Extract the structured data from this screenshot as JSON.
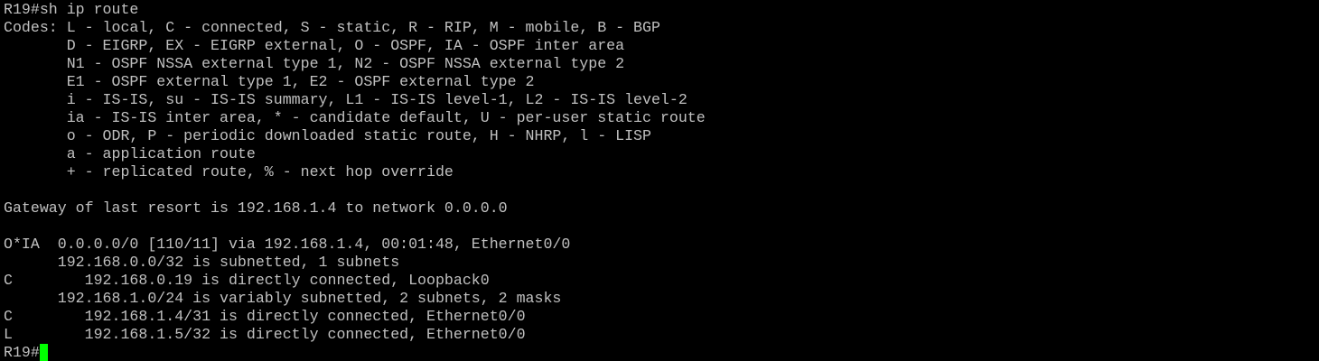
{
  "terminal": {
    "text_color": "#c0c0c0",
    "background_color": "#000000",
    "cursor_color": "#00ff00",
    "lines": [
      "R19#sh ip route",
      "Codes: L - local, C - connected, S - static, R - RIP, M - mobile, B - BGP",
      "       D - EIGRP, EX - EIGRP external, O - OSPF, IA - OSPF inter area",
      "       N1 - OSPF NSSA external type 1, N2 - OSPF NSSA external type 2",
      "       E1 - OSPF external type 1, E2 - OSPF external type 2",
      "       i - IS-IS, su - IS-IS summary, L1 - IS-IS level-1, L2 - IS-IS level-2",
      "       ia - IS-IS inter area, * - candidate default, U - per-user static route",
      "       o - ODR, P - periodic downloaded static route, H - NHRP, l - LISP",
      "       a - application route",
      "       + - replicated route, % - next hop override",
      "",
      "Gateway of last resort is 192.168.1.4 to network 0.0.0.0",
      "",
      "O*IA  0.0.0.0/0 [110/11] via 192.168.1.4, 00:01:48, Ethernet0/0",
      "      192.168.0.0/32 is subnetted, 1 subnets",
      "C        192.168.0.19 is directly connected, Loopback0",
      "      192.168.1.0/24 is variably subnetted, 2 subnets, 2 masks",
      "C        192.168.1.4/31 is directly connected, Ethernet0/0",
      "L        192.168.1.5/32 is directly connected, Ethernet0/0"
    ],
    "prompt": "R19#"
  }
}
